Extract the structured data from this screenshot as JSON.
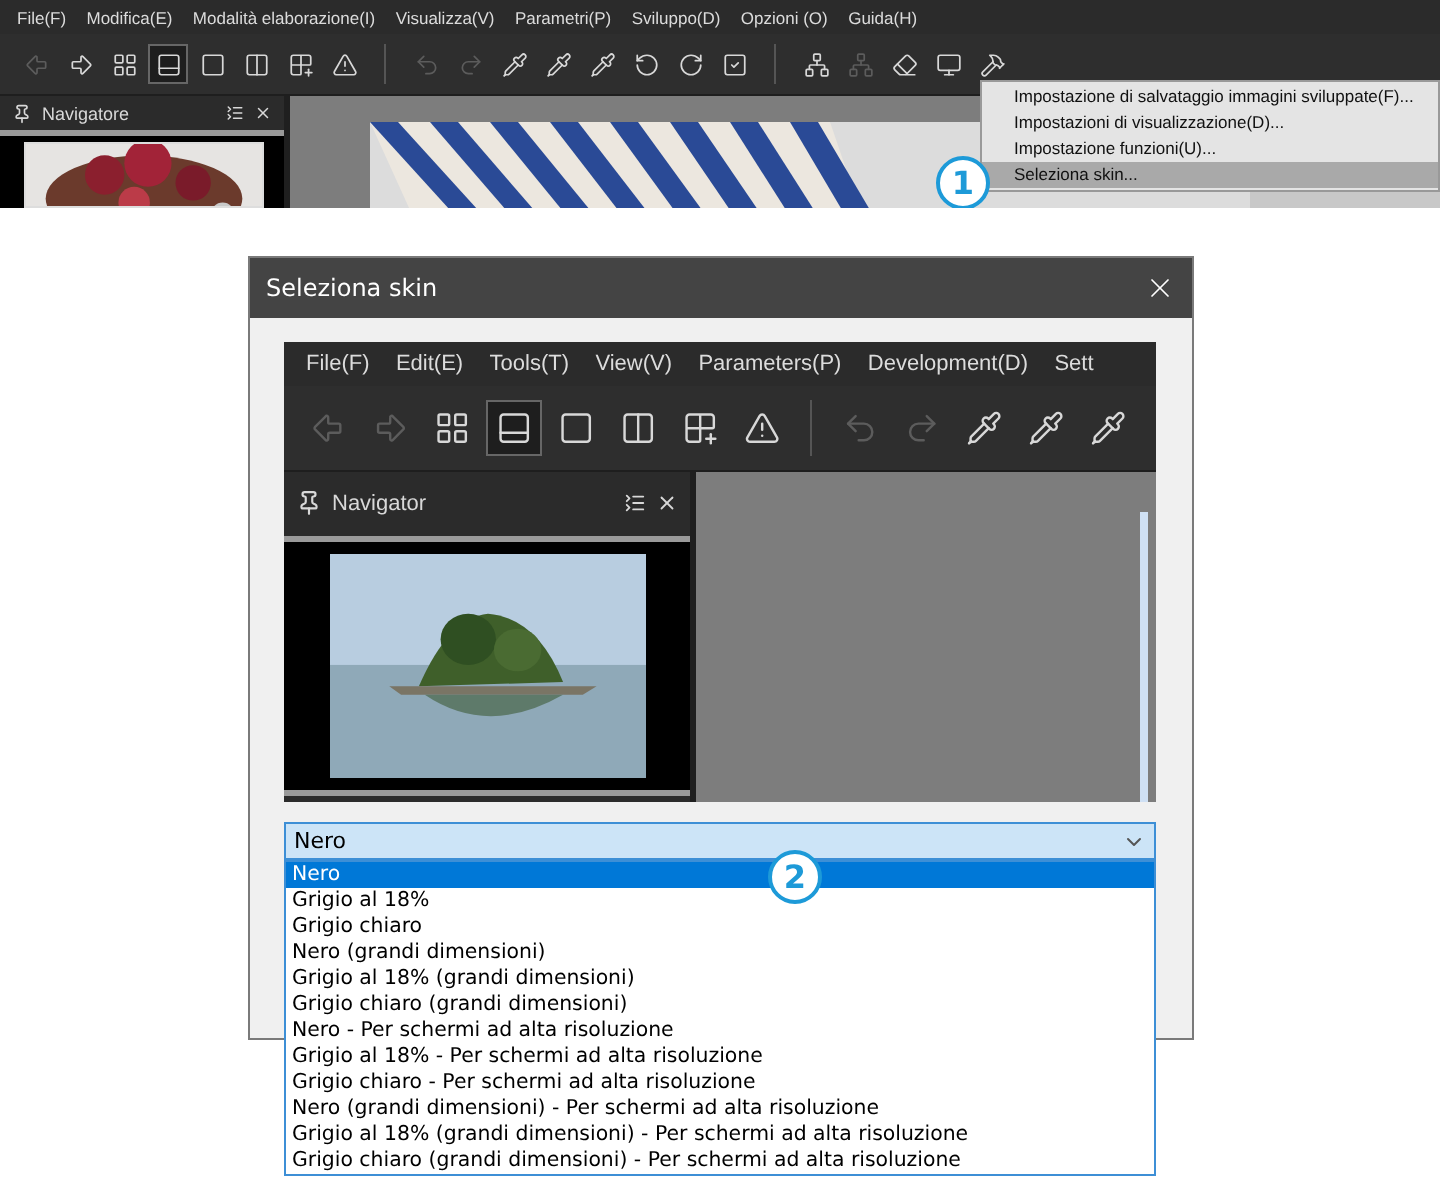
{
  "app": {
    "menu": [
      "File(F)",
      "Modifica(E)",
      "Modalità elaborazione(I)",
      "Visualizza(V)",
      "Parametri(P)",
      "Sviluppo(D)",
      "Opzioni (O)",
      "Guida(H)"
    ],
    "toolbar": {
      "groups": [
        [
          {
            "selected": false,
            "disabled": true
          },
          {
            "selected": false,
            "disabled": false
          },
          {
            "selected": false,
            "disabled": false
          },
          {
            "selected": true,
            "disabled": false
          },
          {
            "selected": false,
            "disabled": false
          },
          {
            "selected": false,
            "disabled": false
          },
          {
            "selected": false,
            "disabled": false
          },
          {
            "selected": false,
            "disabled": false
          }
        ],
        [
          {
            "selected": false,
            "disabled": true
          },
          {
            "selected": false,
            "disabled": true
          },
          {
            "selected": false,
            "disabled": false
          },
          {
            "selected": false,
            "disabled": false
          },
          {
            "selected": false,
            "disabled": false
          },
          {
            "selected": false,
            "disabled": false
          },
          {
            "selected": false,
            "disabled": false
          },
          {
            "selected": false,
            "disabled": false
          }
        ],
        [
          {
            "selected": false,
            "disabled": false
          },
          {
            "selected": false,
            "disabled": true
          },
          {
            "selected": false,
            "disabled": false
          },
          {
            "selected": false,
            "disabled": false
          },
          {
            "selected": false,
            "disabled": false
          }
        ]
      ]
    },
    "navigator": {
      "title": "Navigatore"
    },
    "context_menu": {
      "items": [
        {
          "label": "Impostazione di salvataggio immagini sviluppate(F)...",
          "selected": false
        },
        {
          "label": "Impostazioni di visualizzazione(D)...",
          "selected": false
        },
        {
          "label": "Impostazione funzioni(U)...",
          "selected": false
        },
        {
          "label": "Seleziona skin...",
          "selected": true
        }
      ]
    },
    "callout": "1"
  },
  "dialog": {
    "title": "Seleziona skin",
    "preview": {
      "menu": [
        "File(F)",
        "Edit(E)",
        "Tools(T)",
        "View(V)",
        "Parameters(P)",
        "Development(D)",
        "Sett"
      ],
      "toolbar": {
        "groups": [
          [
            {
              "selected": false,
              "disabled": true
            },
            {
              "selected": false,
              "disabled": true
            },
            {
              "selected": false,
              "disabled": false
            },
            {
              "selected": true,
              "disabled": false
            },
            {
              "selected": false,
              "disabled": false
            },
            {
              "selected": false,
              "disabled": false
            },
            {
              "selected": false,
              "disabled": false
            },
            {
              "selected": false,
              "disabled": false
            }
          ],
          [
            {
              "selected": false,
              "disabled": true
            },
            {
              "selected": false,
              "disabled": true
            },
            {
              "selected": false,
              "disabled": false
            },
            {
              "selected": false,
              "disabled": false
            },
            {
              "selected": false,
              "disabled": false
            }
          ]
        ]
      },
      "navigator": {
        "title": "Navigator"
      }
    },
    "combobox": {
      "value": "Nero",
      "expanded": true,
      "options": [
        {
          "label": "Nero",
          "selected": true
        },
        {
          "label": "Grigio al 18%",
          "selected": false
        },
        {
          "label": "Grigio chiaro",
          "selected": false
        },
        {
          "label": "Nero (grandi dimensioni)",
          "selected": false
        },
        {
          "label": "Grigio al 18% (grandi dimensioni)",
          "selected": false
        },
        {
          "label": "Grigio chiaro (grandi dimensioni)",
          "selected": false
        },
        {
          "label": "Nero - Per schermi ad alta risoluzione",
          "selected": false
        },
        {
          "label": "Grigio al 18% - Per schermi ad alta risoluzione",
          "selected": false
        },
        {
          "label": "Grigio chiaro - Per schermi ad alta risoluzione",
          "selected": false
        },
        {
          "label": "Nero (grandi dimensioni) - Per schermi ad alta risoluzione",
          "selected": false
        },
        {
          "label": "Grigio al 18% (grandi dimensioni) - Per schermi ad alta risoluzione",
          "selected": false
        },
        {
          "label": "Grigio chiaro (grandi dimensioni) - Per schermi ad alta risoluzione",
          "selected": false
        }
      ]
    },
    "callout": "2"
  }
}
